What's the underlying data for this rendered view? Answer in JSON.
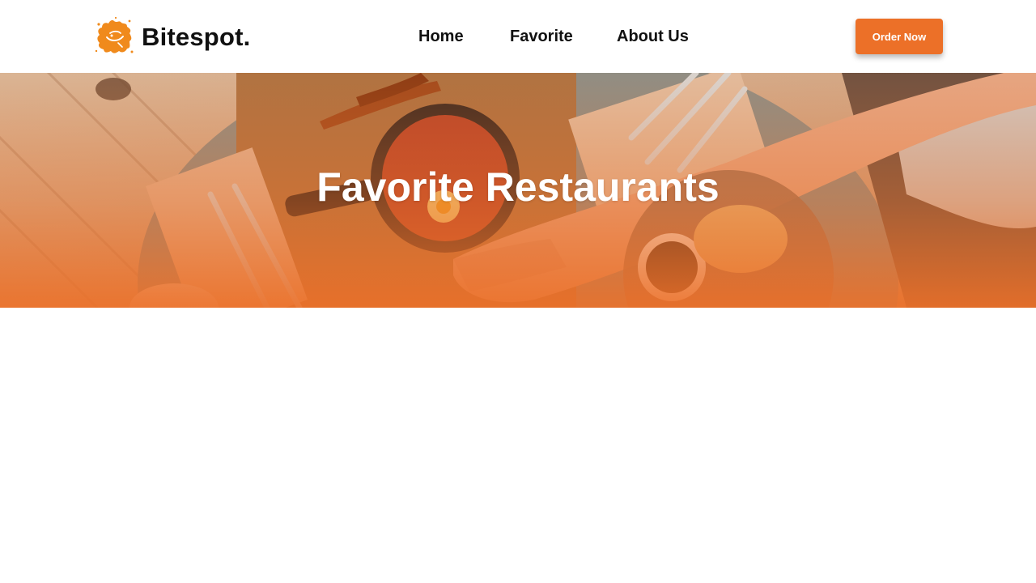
{
  "brand": {
    "name": "Bitespot.",
    "logo_icon": "paint-splash-logo",
    "logo_color": "#f08a1c"
  },
  "nav": {
    "items": [
      {
        "label": "Home"
      },
      {
        "label": "Favorite"
      },
      {
        "label": "About Us"
      }
    ],
    "cta_label": "Order Now"
  },
  "hero": {
    "title": "Favorite Restaurants",
    "overlay_color": "#ec7028",
    "image_description_icon": "food-table-photo"
  },
  "colors": {
    "accent": "#ec7028",
    "text": "#111111",
    "background": "#ffffff"
  }
}
